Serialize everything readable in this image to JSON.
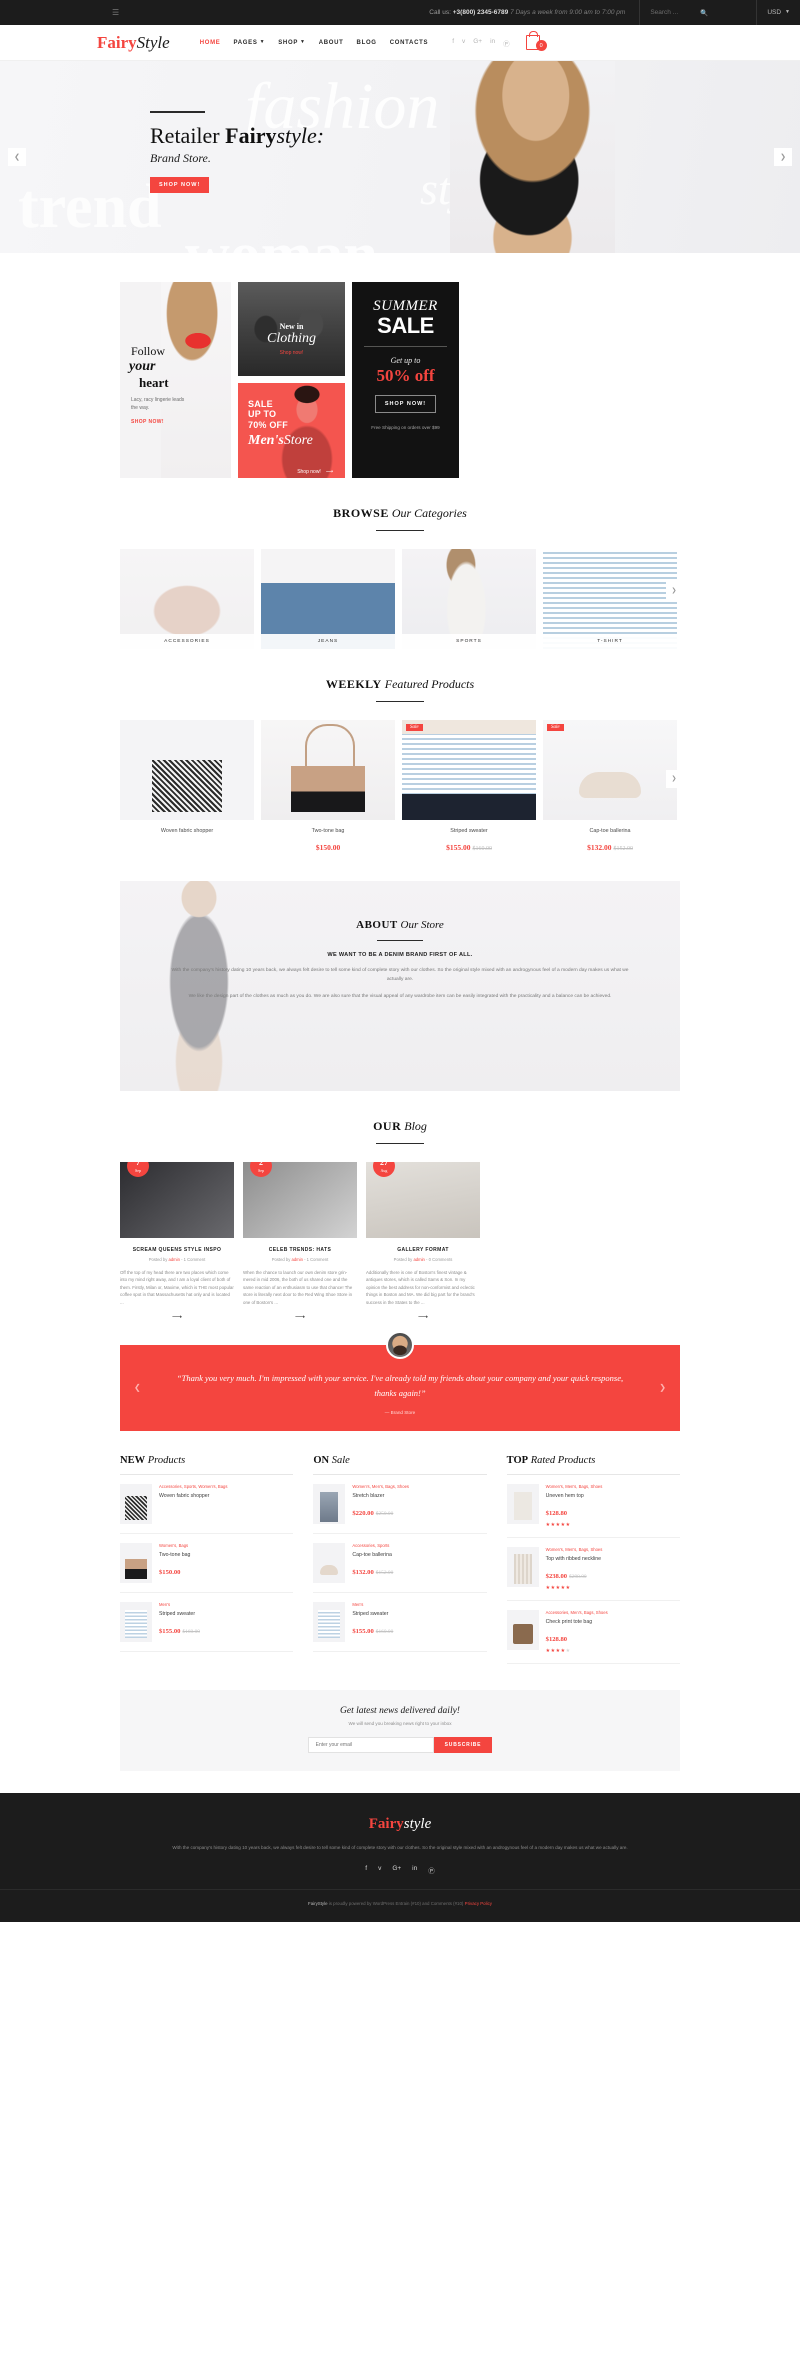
{
  "topbar": {
    "burger_icon": "menu-icon",
    "call_label": "Call us:",
    "phone": "+3(800) 2345-6789",
    "hours": "7 Days a week from 9:00 am to 7:00 pm",
    "search_placeholder": "Search ...",
    "search_icon": "search-icon",
    "currency": "USD"
  },
  "header": {
    "logo_first": "Fairy",
    "logo_second": "Style",
    "nav": [
      {
        "label": "HOME",
        "active": true,
        "caret": ""
      },
      {
        "label": "PAGES",
        "active": false,
        "caret": "⌄"
      },
      {
        "label": "SHOP",
        "active": false,
        "caret": "⌄"
      },
      {
        "label": "ABOUT",
        "active": false,
        "caret": ""
      },
      {
        "label": "BLOG",
        "active": false,
        "caret": ""
      },
      {
        "label": "CONTACTS",
        "active": false,
        "caret": ""
      }
    ],
    "social": [
      "f",
      "ᴠ",
      "G+",
      "in",
      "Ⓟ"
    ],
    "cart_count": "0",
    "accent": "#f4453f"
  },
  "hero": {
    "ghost_fashion": "fashion",
    "ghost_style": "style",
    "ghost_trend": "trend",
    "ghost_woman": "woman",
    "title_plain": "Retailer ",
    "title_bold": "Fairy",
    "title_italic": "style:",
    "subtitle": "Brand Store.",
    "cta": "SHOP NOW!",
    "prev_icon": "chevron-left-icon",
    "next_icon": "chevron-right-icon"
  },
  "promos": {
    "left": {
      "line1": "Follow",
      "line2": "your",
      "line3": "heart",
      "desc": "Lacy, racy lingerie leads the way.",
      "cta": "SHOP NOW!"
    },
    "new_in": {
      "line1": "New in",
      "line2": "Clothing",
      "cta": "Shop now!"
    },
    "mens": {
      "line1": "SALE",
      "line2": "UP TO",
      "line3": "70% OFF",
      "brand_bold": "Men's",
      "brand_italic": "Store",
      "cta": "Shop now!",
      "arrow_icon": "arrow-right-icon"
    },
    "summer": {
      "line1": "SUMMER",
      "line2": "SALE",
      "get": "Get up to",
      "percent": "50% off",
      "cta": "SHOP NOW!",
      "shipping": "Free Shipping on orders over $99"
    }
  },
  "categories": {
    "title_bold": "BROWSE",
    "title_italic": "Our Categories",
    "items": [
      {
        "label": "ACCESSORIES"
      },
      {
        "label": "JEANS"
      },
      {
        "label": "SPORTS"
      },
      {
        "label": "T-SHIRT"
      }
    ],
    "next_icon": "chevron-right-icon"
  },
  "featured": {
    "title_bold": "WEEKLY",
    "title_italic": "Featured Products",
    "items": [
      {
        "name": "Woven fabric shopper",
        "price": "",
        "old": "",
        "badge": ""
      },
      {
        "name": "Two-tone bag",
        "price": "$150.00",
        "old": "",
        "badge": ""
      },
      {
        "name": "Striped sweater",
        "price": "$155.00",
        "old": "$160.00",
        "badge": "Sale"
      },
      {
        "name": "Cap-toe ballerina",
        "price": "$132.00",
        "old": "$152.00",
        "badge": "Sale"
      }
    ],
    "next_icon": "chevron-right-icon"
  },
  "about": {
    "title_bold": "ABOUT",
    "title_italic": "Our Store",
    "subtitle": "WE WANT TO BE A DENIM BRAND FIRST OF ALL.",
    "p1": "With the company's history dating 10 years back, we always felt desire to tell some kind of complete story with our clothes. So the original style mixed with an androgynous feel of a modern day makes us what we actually are.",
    "p2": "We like the design part of the clothes as much as you do. We are also sure that the visual appeal of any wardrobe item can be easily integrated with the practicality and a balance can be achieved."
  },
  "blog": {
    "title_bold": "OUR",
    "title_italic": "Blog",
    "posts": [
      {
        "day": "7",
        "month": "Sep",
        "title": "SCREAM QUEENS STYLE INSPO",
        "meta_prefix": "Posted by ",
        "author": "admin",
        "comments": "1 Comment",
        "excerpt": "Off the top of my head there are two places which come into my mind right away, and I am a loyal client of both of them. Firstly, Milan or, Maxime, which is THE most popular coffee spot in that Massachusetts hat only and is located ...",
        "arrow_icon": "arrow-right-icon"
      },
      {
        "day": "2",
        "month": "Sep",
        "title": "CELEB TRENDS: HATS",
        "meta_prefix": "Posted by ",
        "author": "admin",
        "comments": "1 Comment",
        "excerpt": "When the chance to launch our own denim store grin-mered in mid 2006, the both of us shared one and the same reaction of an enthusiasm to use that chance! The store is literally next door to the Red Wing Shoe Store in one of Boston's ...",
        "arrow_icon": "arrow-right-icon"
      },
      {
        "day": "27",
        "month": "Aug",
        "title": "GALLERY FORMAT",
        "meta_prefix": "Posted by ",
        "author": "admin",
        "comments": "0 Comments",
        "excerpt": "Additionally there is one of Boston's finest vintage & antiques stores, which is called Sams & Son. In my opinion the best address for non-conformist and eclectic things in Boston and MA. We did big part for the brand's success in the States to the ...",
        "arrow_icon": "arrow-right-icon"
      }
    ]
  },
  "testimonial": {
    "quote": "“Thank you very much. I'm impressed with your service. I've already told my friends about your company and your quick response, thanks again!”",
    "author": "— Brand Store",
    "prev_icon": "chevron-left-icon",
    "next_icon": "chevron-right-icon",
    "avatar_icon": "avatar"
  },
  "lists": [
    {
      "title_bold": "NEW",
      "title_italic": "Products",
      "items": [
        {
          "cats": "Accessories, Sports, Women's, Bags",
          "name": "Woven fabric shopper",
          "price": "",
          "old": "",
          "stars": 0,
          "thumb": "t-shop"
        },
        {
          "cats": "Women's, Bags",
          "name": "Two-tone bag",
          "price": "$150.00",
          "old": "",
          "stars": 0,
          "thumb": "t-two"
        },
        {
          "cats": "Men's",
          "name": "Striped sweater",
          "price": "$155.00",
          "old": "$160.00",
          "stars": 0,
          "thumb": "t-swt"
        }
      ]
    },
    {
      "title_bold": "ON",
      "title_italic": "Sale",
      "items": [
        {
          "cats": "Women's, Men's, Bags, Shoes",
          "name": "Stretch blazer",
          "price": "$220.00",
          "old": "$250.00",
          "stars": 0,
          "thumb": "t-blaz"
        },
        {
          "cats": "Accessories, Sports",
          "name": "Cap-toe ballerina",
          "price": "$132.00",
          "old": "$152.00",
          "stars": 0,
          "thumb": "t-bal"
        },
        {
          "cats": "Men's",
          "name": "Striped sweater",
          "price": "$155.00",
          "old": "$160.00",
          "stars": 0,
          "thumb": "t-swt"
        }
      ]
    },
    {
      "title_bold": "TOP",
      "title_italic": "Rated Products",
      "items": [
        {
          "cats": "Women's, Men's, Bags, Shoes",
          "name": "Uneven hem top",
          "price": "$128.80",
          "old": "",
          "stars": 5,
          "thumb": "t-top"
        },
        {
          "cats": "Women's, Men's, Bags, Shoes",
          "name": "Top with ribbed neckline",
          "price": "$238.00",
          "old": "$298.00",
          "stars": 5,
          "thumb": "t-rib"
        },
        {
          "cats": "Accessories, Men's, Bags, Shoes",
          "name": "Check print tote bag",
          "price": "$128.80",
          "old": "",
          "stars": 4,
          "thumb": "t-tote"
        }
      ]
    }
  ],
  "newsletter": {
    "title": "Get latest news delivered daily!",
    "subtitle": "We will send you breaking news right to your inbox",
    "placeholder": "Enter your email",
    "button": "SUBSCRIBE"
  },
  "footer": {
    "logo_first": "Fairy",
    "logo_second": "style",
    "text": "With the company's history dating 10 years back, we always felt desire to tell some kind of complete story with our clothes. So the original style mixed with an androgynous feel of a modern day makes us what we actually are.",
    "social": [
      "f",
      "ᴠ",
      "G+",
      "in",
      "Ⓟ"
    ],
    "copy_brand": "FairyStyle",
    "copy_text": " is proudly powered by WordPress Entrain (#10) and Comments (#10)",
    "privacy": "Privacy Policy"
  }
}
